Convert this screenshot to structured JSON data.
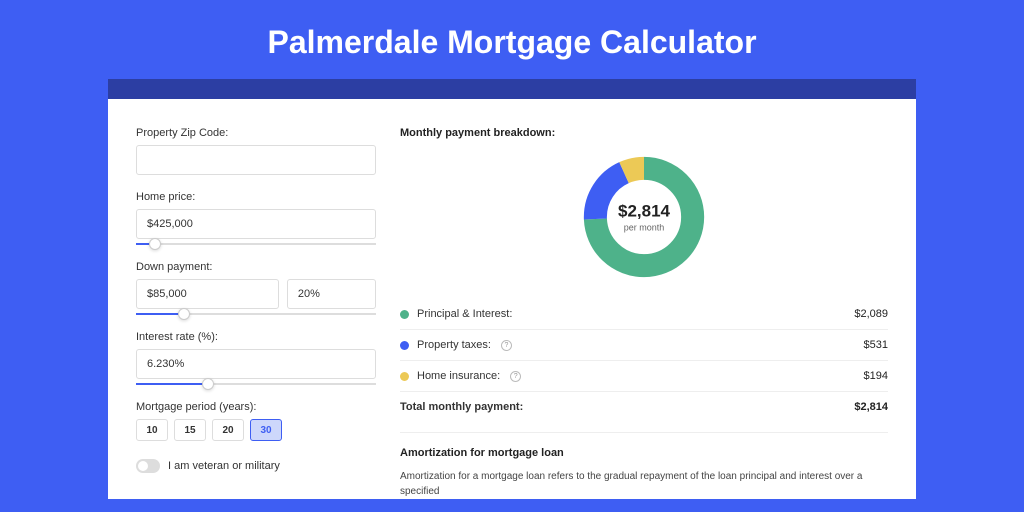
{
  "page": {
    "title": "Palmerdale Mortgage Calculator"
  },
  "form": {
    "zip": {
      "label": "Property Zip Code:",
      "value": ""
    },
    "home_price": {
      "label": "Home price:",
      "value": "$425,000",
      "slider_pct": 8
    },
    "down_payment": {
      "label": "Down payment:",
      "value": "$85,000",
      "pct": "20%",
      "slider_pct": 20
    },
    "interest": {
      "label": "Interest rate (%):",
      "value": "6.230%",
      "slider_pct": 30
    },
    "period": {
      "label": "Mortgage period (years):",
      "options": [
        "10",
        "15",
        "20",
        "30"
      ],
      "selected": "30"
    },
    "veteran": {
      "label": "I am veteran or military",
      "checked": false
    }
  },
  "breakdown": {
    "title": "Monthly payment breakdown:",
    "total_amount": "$2,814",
    "total_sub": "per month",
    "items": [
      {
        "label": "Principal & Interest:",
        "value": "$2,089",
        "color": "#4eb28a",
        "info": false,
        "pct": 0.742
      },
      {
        "label": "Property taxes:",
        "value": "$531",
        "color": "#3e5ef3",
        "info": true,
        "pct": 0.189
      },
      {
        "label": "Home insurance:",
        "value": "$194",
        "color": "#ecc956",
        "info": true,
        "pct": 0.069
      }
    ],
    "total_row": {
      "label": "Total monthly payment:",
      "value": "$2,814"
    }
  },
  "amort": {
    "title": "Amortization for mortgage loan",
    "text": "Amortization for a mortgage loan refers to the gradual repayment of the loan principal and interest over a specified"
  },
  "chart_data": {
    "type": "pie",
    "title": "Monthly payment breakdown",
    "series": [
      {
        "name": "Principal & Interest",
        "value": 2089,
        "color": "#4eb28a"
      },
      {
        "name": "Property taxes",
        "value": 531,
        "color": "#3e5ef3"
      },
      {
        "name": "Home insurance",
        "value": 194,
        "color": "#ecc956"
      }
    ],
    "total": 2814,
    "center_label": "$2,814 per month"
  }
}
